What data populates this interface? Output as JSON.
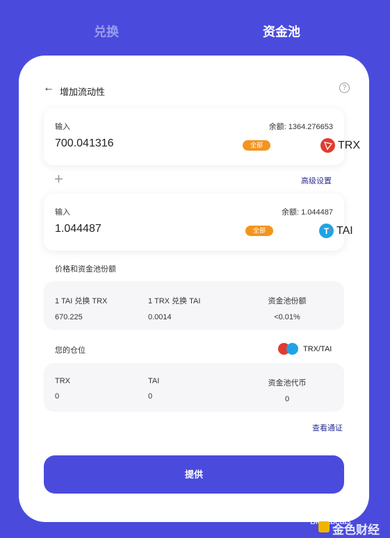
{
  "tabs": {
    "swap": "兑换",
    "pool": "资金池"
  },
  "header": {
    "back_icon": "←",
    "title": "增加流动性",
    "help_icon": "?"
  },
  "input1": {
    "label": "输入",
    "balance": "余额: 1364.276653",
    "amount": "700.041316",
    "max_label": "全部",
    "token_icon": "trx-icon",
    "token": "TRX"
  },
  "plus": "+",
  "advanced": "高级设置",
  "input2": {
    "label": "输入",
    "balance": "余额: 1.044487",
    "amount": "1.044487",
    "max_label": "全部",
    "token_icon": "tai-icon",
    "token": "TAI",
    "caret": "▼"
  },
  "price_section": {
    "label": "价格和资金池份额",
    "cols": [
      {
        "label": "1 TAI 兑换 TRX",
        "value": "670.225"
      },
      {
        "label": "1 TRX 兑换 TAI",
        "value": "0.0014"
      },
      {
        "label": "资金池份额",
        "value": "<0.01%"
      }
    ]
  },
  "position_section": {
    "label": "您的仓位",
    "pair": "TRX/TAI",
    "cols": [
      {
        "label": "TRX",
        "value": "0"
      },
      {
        "label": "TAI",
        "value": "0"
      },
      {
        "label": "资金池代币",
        "value": "0"
      }
    ]
  },
  "view_link": "查看通证",
  "supply_button": "提供",
  "watermark": {
    "text": "Blockbeats",
    "brand": "金色财经"
  },
  "colors": {
    "background": "#4a4bdc",
    "accent": "#f3941f",
    "link": "#2e3192",
    "trx": "#e23b2e",
    "tai": "#1fa3e8"
  }
}
